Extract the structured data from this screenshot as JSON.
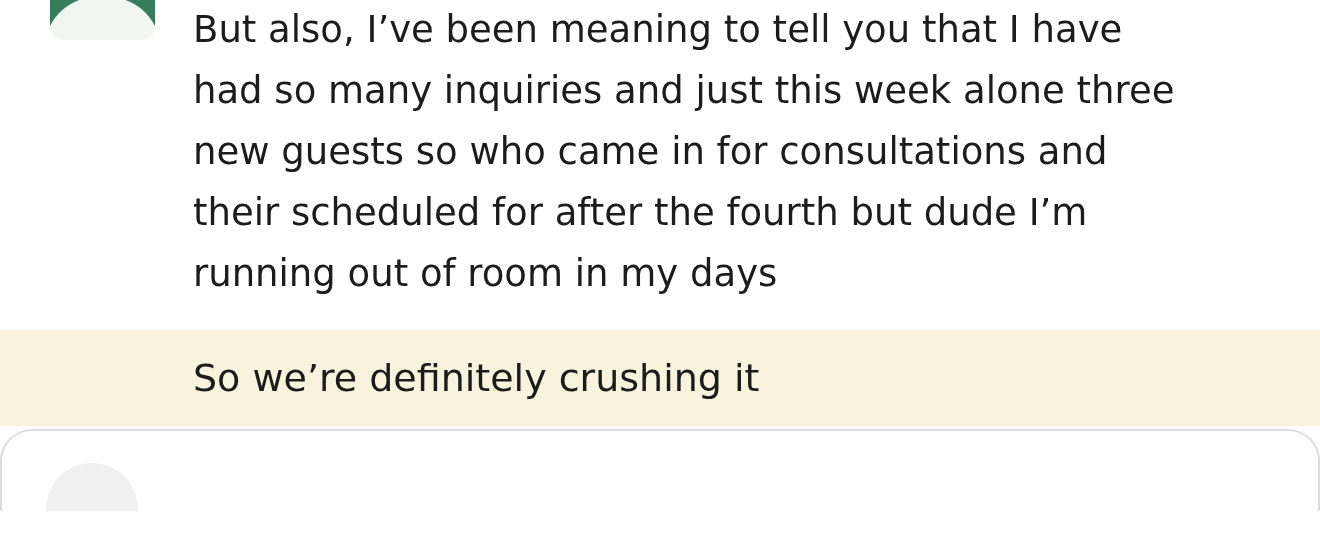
{
  "messages": [
    {
      "text": "But also, I’ve been meaning to tell you that I have had so many inquiries and just this week alone three new guests so who came in for consultations and their scheduled for after the fourth but dude I’m running out of room in my days",
      "highlighted": false,
      "avatar": true
    },
    {
      "text": "So we’re definitely crushing it",
      "highlighted": true,
      "avatar": false
    }
  ],
  "composer": {
    "avatar": true
  }
}
